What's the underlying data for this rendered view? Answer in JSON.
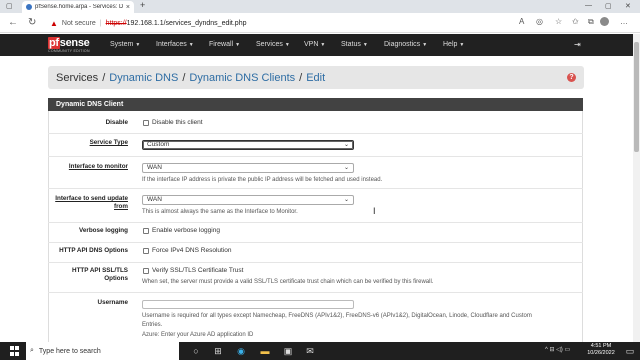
{
  "browser": {
    "tab_title": "pfSense.home.arpa - Services: D",
    "tab_close": "×",
    "new_tab": "+",
    "not_secure": "Not secure",
    "url_scheme": "https://",
    "url_rest": "192.168.1.1/services_dyndns_edit.php",
    "icons": [
      "back-icon",
      "refresh-icon",
      "read-aloud-icon",
      "favorite-icon",
      "collections-icon",
      "profile-icon",
      "menu-icon"
    ]
  },
  "nav": {
    "logo_main": "pf",
    "logo_rest": "sense",
    "logo_sub": "COMMUNITY EDITION",
    "menus": [
      "System",
      "Interfaces",
      "Firewall",
      "Services",
      "VPN",
      "Status",
      "Diagnostics",
      "Help"
    ],
    "logout_icon": "logout-icon"
  },
  "breadcrumb": {
    "root": "Services",
    "items": [
      "Dynamic DNS",
      "Dynamic DNS Clients",
      "Edit"
    ],
    "sep": "/"
  },
  "panel": {
    "title": "Dynamic DNS Client",
    "disable": {
      "label": "Disable",
      "check": "Disable this client"
    },
    "service_type": {
      "label": "Service Type",
      "value": "Custom"
    },
    "iface_monitor": {
      "label": "Interface to monitor",
      "value": "WAN",
      "help": "If the interface IP address is private the public IP address will be fetched and used instead."
    },
    "iface_update": {
      "label_1": "Interface to send update",
      "label_2": "from",
      "value": "WAN",
      "help": "This is almost always the same as the Interface to Monitor."
    },
    "verbose": {
      "label": "Verbose logging",
      "check": "Enable verbose logging"
    },
    "http_dns": {
      "label": "HTTP API DNS Options",
      "check": "Force IPv4 DNS Resolution"
    },
    "http_ssl": {
      "label_1": "HTTP API SSL/TLS",
      "label_2": "Options",
      "check": "Verify SSL/TLS Certificate Trust",
      "help": "When set, the server must provide a valid SSL/TLS certificate trust chain which can be verified by this firewall."
    },
    "username": {
      "label": "Username",
      "help_1": "Username is required for all types except Namecheap, FreeDNS (APIv1&2), FreeDNS-v6 (APIv1&2), DigitalOcean, Linode, Cloudflare and Custom",
      "help_2": "Entries.",
      "help_3": "Azure: Enter your Azure AD application ID"
    }
  },
  "taskbar": {
    "search_placeholder": "Type here to search",
    "time": "4:51 PM",
    "date": "10/26/2022"
  }
}
